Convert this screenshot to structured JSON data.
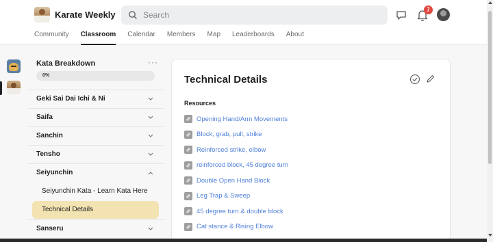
{
  "header": {
    "group_name": "Karate Weekly",
    "search_placeholder": "Search",
    "notification_count": "7",
    "tabs": [
      {
        "label": "Community",
        "active": false
      },
      {
        "label": "Classroom",
        "active": true
      },
      {
        "label": "Calendar",
        "active": false
      },
      {
        "label": "Members",
        "active": false
      },
      {
        "label": "Map",
        "active": false
      },
      {
        "label": "Leaderboards",
        "active": false
      },
      {
        "label": "About",
        "active": false
      }
    ]
  },
  "sidebar": {
    "course_title": "Kata Breakdown",
    "more_label": "···",
    "progress_label": "0%",
    "progress_value": 0,
    "modules": [
      {
        "label": "Geki Sai Dai Ichi & Ni",
        "expanded": false
      },
      {
        "label": "Saifa",
        "expanded": false
      },
      {
        "label": "Sanchin",
        "expanded": false
      },
      {
        "label": "Tensho",
        "expanded": false
      },
      {
        "label": "Seiyunchin",
        "expanded": true
      },
      {
        "label": "Sanseru",
        "expanded": false
      }
    ],
    "lessons": [
      {
        "label": "Seiyunchin Kata - Learn Kata Here",
        "active": false
      },
      {
        "label": "Technical Details",
        "active": true
      }
    ]
  },
  "main": {
    "title": "Technical Details",
    "resources_heading": "Resources",
    "resources": [
      "Opening Hand/Arm Movements",
      "Block, grab, pull, strike",
      "Reinforced strike, elbow",
      "reinforced block, 45 degree turn",
      "Double Open Hand Block",
      "Leg Trap & Sweep",
      "45 degree turn & double block",
      "Cat stance & Rising Elbow"
    ]
  },
  "colors": {
    "accent_link": "#4f7fd8",
    "active_lesson_bg": "#f4e3b2",
    "badge": "#e0483e"
  }
}
